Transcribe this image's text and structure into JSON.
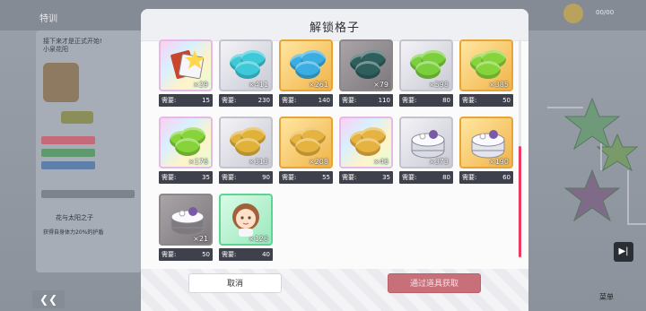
{
  "background": {
    "title": "特训",
    "note": "接下来才是正式开始!\n小泉花阳",
    "skill_title": "花与太阳之子",
    "skill_desc": "获得自身体力20%的护盾",
    "counter": "00/00",
    "back_glyph": "❮❮",
    "next_glyph": "▶|",
    "menu_label": "菜单"
  },
  "dialog": {
    "title": "解锁格子",
    "cancel_label": "取消",
    "obtain_label": "通过道具获取",
    "need_label": "需要:",
    "items": [
      {
        "kind": "ticket",
        "frame": "rainbow",
        "qty": "×29",
        "need": "15"
      },
      {
        "kind": "macaron",
        "frame": "silver",
        "color": "#3dc9d8",
        "qty": "×411",
        "need": "230"
      },
      {
        "kind": "macaron",
        "frame": "gold",
        "color": "#3aaee0",
        "qty": "×261",
        "need": "140"
      },
      {
        "kind": "macaron",
        "frame": "dark",
        "color": "#2f5f5c",
        "qty": "×79",
        "need": "110"
      },
      {
        "kind": "macaron",
        "frame": "silver",
        "color": "#7ccf3c",
        "qty": "×598",
        "need": "80"
      },
      {
        "kind": "macaron",
        "frame": "gold",
        "color": "#86d43a",
        "qty": "×385",
        "need": "50"
      },
      {
        "kind": "macaron",
        "frame": "rainbow",
        "color": "#86d43a",
        "qty": "×176",
        "need": "35"
      },
      {
        "kind": "macaron",
        "frame": "silver",
        "color": "#e0b23a",
        "qty": "×313",
        "need": "90"
      },
      {
        "kind": "macaron",
        "frame": "gold",
        "color": "#e7b340",
        "qty": "×208",
        "need": "55"
      },
      {
        "kind": "macaron",
        "frame": "rainbow",
        "color": "#e7b340",
        "qty": "×46",
        "need": "35"
      },
      {
        "kind": "cake",
        "frame": "silver",
        "color": "#d9dbe4",
        "qty": "×373",
        "need": "80"
      },
      {
        "kind": "cake",
        "frame": "gold",
        "color": "#e4e4ee",
        "qty": "×190",
        "need": "60"
      },
      {
        "kind": "cake",
        "frame": "dark",
        "color": "#7e7a7e",
        "qty": "×21",
        "need": "50"
      },
      {
        "kind": "character",
        "frame": "green",
        "qty": "×126",
        "need": "40"
      }
    ]
  },
  "colors": {
    "accent": "#ee3b64",
    "need_bar": "#3e414b"
  }
}
